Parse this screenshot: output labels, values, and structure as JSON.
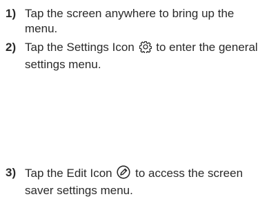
{
  "steps": [
    {
      "number": "1)",
      "text": "Tap the screen anywhere to bring up the menu."
    },
    {
      "number": "2)",
      "before": "Tap the Settings Icon",
      "icon": "gear-icon",
      "after": "to enter the general settings menu."
    },
    {
      "number": "3)",
      "before": "Tap the Edit Icon",
      "icon": "pencil-circle-icon",
      "after": "to access the screen saver settings menu."
    }
  ]
}
